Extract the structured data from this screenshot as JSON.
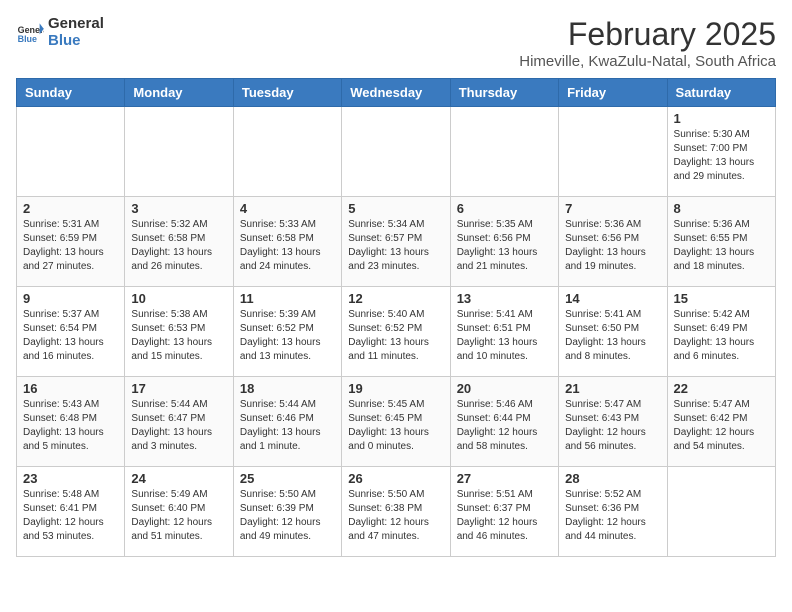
{
  "logo": {
    "general": "General",
    "blue": "Blue"
  },
  "title": "February 2025",
  "subtitle": "Himeville, KwaZulu-Natal, South Africa",
  "weekdays": [
    "Sunday",
    "Monday",
    "Tuesday",
    "Wednesday",
    "Thursday",
    "Friday",
    "Saturday"
  ],
  "weeks": [
    [
      {
        "day": "",
        "info": ""
      },
      {
        "day": "",
        "info": ""
      },
      {
        "day": "",
        "info": ""
      },
      {
        "day": "",
        "info": ""
      },
      {
        "day": "",
        "info": ""
      },
      {
        "day": "",
        "info": ""
      },
      {
        "day": "1",
        "info": "Sunrise: 5:30 AM\nSunset: 7:00 PM\nDaylight: 13 hours and 29 minutes."
      }
    ],
    [
      {
        "day": "2",
        "info": "Sunrise: 5:31 AM\nSunset: 6:59 PM\nDaylight: 13 hours and 27 minutes."
      },
      {
        "day": "3",
        "info": "Sunrise: 5:32 AM\nSunset: 6:58 PM\nDaylight: 13 hours and 26 minutes."
      },
      {
        "day": "4",
        "info": "Sunrise: 5:33 AM\nSunset: 6:58 PM\nDaylight: 13 hours and 24 minutes."
      },
      {
        "day": "5",
        "info": "Sunrise: 5:34 AM\nSunset: 6:57 PM\nDaylight: 13 hours and 23 minutes."
      },
      {
        "day": "6",
        "info": "Sunrise: 5:35 AM\nSunset: 6:56 PM\nDaylight: 13 hours and 21 minutes."
      },
      {
        "day": "7",
        "info": "Sunrise: 5:36 AM\nSunset: 6:56 PM\nDaylight: 13 hours and 19 minutes."
      },
      {
        "day": "8",
        "info": "Sunrise: 5:36 AM\nSunset: 6:55 PM\nDaylight: 13 hours and 18 minutes."
      }
    ],
    [
      {
        "day": "9",
        "info": "Sunrise: 5:37 AM\nSunset: 6:54 PM\nDaylight: 13 hours and 16 minutes."
      },
      {
        "day": "10",
        "info": "Sunrise: 5:38 AM\nSunset: 6:53 PM\nDaylight: 13 hours and 15 minutes."
      },
      {
        "day": "11",
        "info": "Sunrise: 5:39 AM\nSunset: 6:52 PM\nDaylight: 13 hours and 13 minutes."
      },
      {
        "day": "12",
        "info": "Sunrise: 5:40 AM\nSunset: 6:52 PM\nDaylight: 13 hours and 11 minutes."
      },
      {
        "day": "13",
        "info": "Sunrise: 5:41 AM\nSunset: 6:51 PM\nDaylight: 13 hours and 10 minutes."
      },
      {
        "day": "14",
        "info": "Sunrise: 5:41 AM\nSunset: 6:50 PM\nDaylight: 13 hours and 8 minutes."
      },
      {
        "day": "15",
        "info": "Sunrise: 5:42 AM\nSunset: 6:49 PM\nDaylight: 13 hours and 6 minutes."
      }
    ],
    [
      {
        "day": "16",
        "info": "Sunrise: 5:43 AM\nSunset: 6:48 PM\nDaylight: 13 hours and 5 minutes."
      },
      {
        "day": "17",
        "info": "Sunrise: 5:44 AM\nSunset: 6:47 PM\nDaylight: 13 hours and 3 minutes."
      },
      {
        "day": "18",
        "info": "Sunrise: 5:44 AM\nSunset: 6:46 PM\nDaylight: 13 hours and 1 minute."
      },
      {
        "day": "19",
        "info": "Sunrise: 5:45 AM\nSunset: 6:45 PM\nDaylight: 13 hours and 0 minutes."
      },
      {
        "day": "20",
        "info": "Sunrise: 5:46 AM\nSunset: 6:44 PM\nDaylight: 12 hours and 58 minutes."
      },
      {
        "day": "21",
        "info": "Sunrise: 5:47 AM\nSunset: 6:43 PM\nDaylight: 12 hours and 56 minutes."
      },
      {
        "day": "22",
        "info": "Sunrise: 5:47 AM\nSunset: 6:42 PM\nDaylight: 12 hours and 54 minutes."
      }
    ],
    [
      {
        "day": "23",
        "info": "Sunrise: 5:48 AM\nSunset: 6:41 PM\nDaylight: 12 hours and 53 minutes."
      },
      {
        "day": "24",
        "info": "Sunrise: 5:49 AM\nSunset: 6:40 PM\nDaylight: 12 hours and 51 minutes."
      },
      {
        "day": "25",
        "info": "Sunrise: 5:50 AM\nSunset: 6:39 PM\nDaylight: 12 hours and 49 minutes."
      },
      {
        "day": "26",
        "info": "Sunrise: 5:50 AM\nSunset: 6:38 PM\nDaylight: 12 hours and 47 minutes."
      },
      {
        "day": "27",
        "info": "Sunrise: 5:51 AM\nSunset: 6:37 PM\nDaylight: 12 hours and 46 minutes."
      },
      {
        "day": "28",
        "info": "Sunrise: 5:52 AM\nSunset: 6:36 PM\nDaylight: 12 hours and 44 minutes."
      },
      {
        "day": "",
        "info": ""
      }
    ]
  ]
}
